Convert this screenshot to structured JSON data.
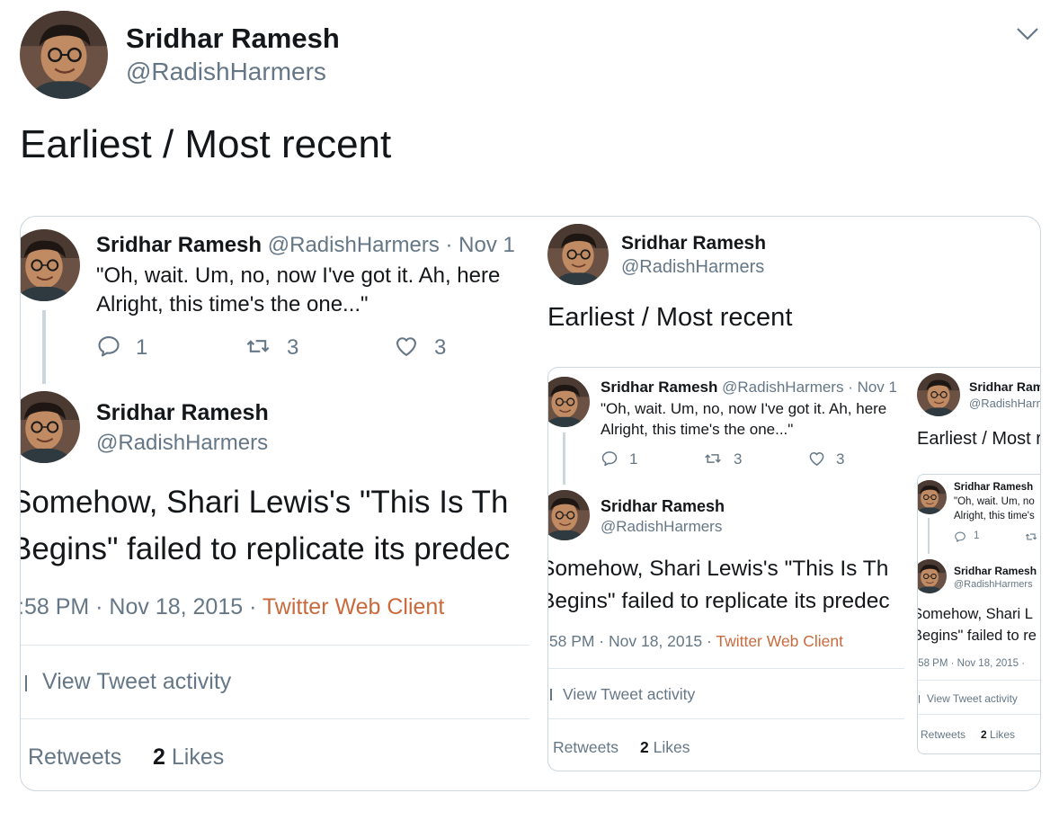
{
  "tweet": {
    "author_name": "Sridhar Ramesh",
    "author_handle": "@RadishHarmers",
    "text": "Earliest / Most recent"
  },
  "level1": {
    "quoted": {
      "author_name": "Sridhar Ramesh",
      "handle_date": "@RadishHarmers · Nov 1",
      "line1": "\"Oh, wait. Um, no, now I've got it. Ah, here",
      "line2": "Alright, this time's the one...\"",
      "replies": "1",
      "retweets": "3",
      "likes": "3"
    },
    "main": {
      "author_name": "Sridhar Ramesh",
      "author_handle": "@RadishHarmers",
      "line1": "Somehow, Shari Lewis's \"This Is Th",
      "line2": "Begins\" failed to replicate its predec",
      "time_prefix": ":58 PM · Nov 18, 2015 · ",
      "client": "Twitter Web Client"
    },
    "activity": "View Tweet activity",
    "stats": {
      "retweets_label": "Retweets",
      "likes_count": "2",
      "likes_label": "Likes"
    }
  },
  "level2": {
    "tweet_author_name": "Sridhar Ramesh",
    "tweet_author_handle": "@RadishHarmers",
    "tweet_text": "Earliest / Most recent",
    "quoted": {
      "author_name": "Sridhar Ramesh",
      "handle_date": "@RadishHarmers · Nov 1",
      "line1": "\"Oh, wait. Um, no, now I've got it. Ah, here",
      "line2": "Alright, this time's the one...\"",
      "replies": "1",
      "retweets": "3",
      "likes": "3"
    },
    "main": {
      "author_name": "Sridhar Ramesh",
      "author_handle": "@RadishHarmers",
      "line1": "Somehow, Shari Lewis's \"This Is Th",
      "line2": "Begins\" failed to replicate its predec",
      "time_prefix": ":58 PM · Nov 18, 2015 · ",
      "client": "Twitter Web Client"
    },
    "activity": "View Tweet activity",
    "stats": {
      "retweets_label": "Retweets",
      "likes_count": "2",
      "likes_label": "Likes"
    }
  },
  "level3": {
    "tweet_author_name": "Sridhar Ramesh",
    "tweet_author_handle": "@RadishHarmers",
    "tweet_text": "Earliest / Most recent",
    "quoted": {
      "author_name": "Sridhar Ramesh",
      "line1": "\"Oh, wait. Um, no",
      "line2": "Alright, this time's",
      "replies": "1"
    },
    "main": {
      "author_name": "Sridhar Ramesh",
      "author_handle": "@RadishHarmers",
      "line1": "Somehow, Shari L",
      "line2": "Begins\" failed to re",
      "time": ":58 PM · Nov 18, 2015 ·"
    },
    "activity": "View Tweet activity",
    "stats": {
      "retweets_label": "Retweets",
      "likes_count": "2",
      "likes_label": "Likes"
    }
  },
  "colors": {
    "text": "#14171a",
    "secondary": "#657786",
    "client_link": "#c96a3c",
    "border": "#e1e8ed"
  },
  "icons": [
    "chevron-down-icon",
    "reply-icon",
    "retweet-icon",
    "like-icon",
    "avatar"
  ]
}
